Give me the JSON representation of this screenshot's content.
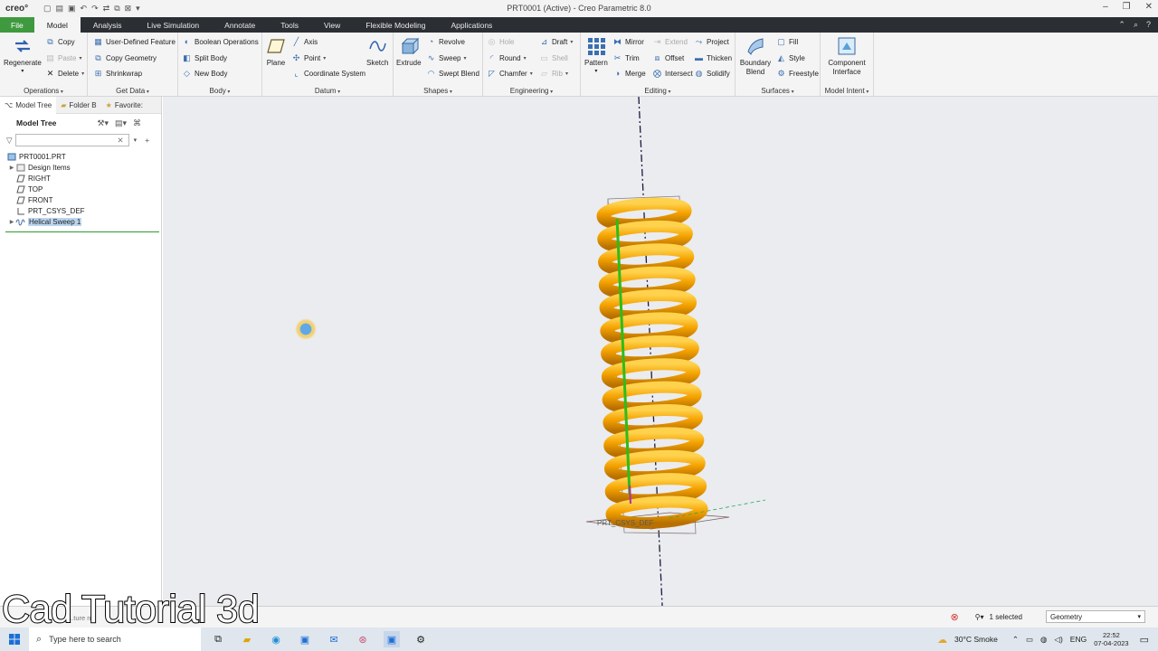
{
  "app": {
    "logo": "creo°",
    "window_title": "PRT0001 (Active) - Creo Parametric 8.0"
  },
  "menu": {
    "tabs": [
      "File",
      "Model",
      "Analysis",
      "Live Simulation",
      "Annotate",
      "Tools",
      "View",
      "Flexible Modeling",
      "Applications"
    ]
  },
  "ribbon": {
    "operations": {
      "title": "Operations",
      "regenerate": "Regenerate",
      "copy": "Copy",
      "paste": "Paste",
      "delete": "Delete"
    },
    "get_data": {
      "title": "Get Data",
      "udf": "User-Defined Feature",
      "copy_geometry": "Copy Geometry",
      "shrinkwrap": "Shrinkwrap"
    },
    "body": {
      "title": "Body",
      "boolean": "Boolean Operations",
      "split": "Split Body",
      "new": "New Body"
    },
    "datum": {
      "title": "Datum",
      "plane": "Plane",
      "axis": "Axis",
      "point": "Point",
      "csys": "Coordinate System",
      "sketch": "Sketch"
    },
    "shapes": {
      "title": "Shapes",
      "extrude": "Extrude",
      "revolve": "Revolve",
      "sweep": "Sweep",
      "swept_blend": "Swept Blend"
    },
    "engineering": {
      "title": "Engineering",
      "hole": "Hole",
      "round": "Round",
      "chamfer": "Chamfer",
      "draft": "Draft",
      "shell": "Shell",
      "rib": "Rib"
    },
    "editing": {
      "title": "Editing",
      "pattern": "Pattern",
      "mirror": "Mirror",
      "trim": "Trim",
      "merge": "Merge",
      "extend": "Extend",
      "offset": "Offset",
      "intersect": "Intersect",
      "project": "Project",
      "thicken": "Thicken",
      "solidify": "Solidify"
    },
    "surfaces": {
      "title": "Surfaces",
      "boundary_blend": "Boundary Blend",
      "fill": "Fill",
      "style": "Style",
      "freestyle": "Freestyle"
    },
    "model_intent": {
      "title": "Model Intent",
      "component_interface": "Component Interface"
    }
  },
  "left_panel": {
    "tabs": [
      "Model Tree",
      "Folder B",
      "Favorite:"
    ],
    "tree_title": "Model Tree",
    "search_placeholder": "",
    "items": [
      {
        "label": "PRT0001.PRT"
      },
      {
        "label": "Design Items"
      },
      {
        "label": "RIGHT"
      },
      {
        "label": "TOP"
      },
      {
        "label": "FRONT"
      },
      {
        "label": "PRT_CSYS_DEF"
      },
      {
        "label": "Helical Sweep 1"
      }
    ]
  },
  "viewport": {
    "csys_label": "PRT_CSYS_DEF"
  },
  "status": {
    "hint": "...ture n...",
    "selected": "1 selected",
    "filter": "Geometry"
  },
  "watermark": "Cad Tutorial 3d",
  "taskbar": {
    "search_placeholder": "Type here to search",
    "weather": "30°C  Smoke",
    "lang": "ENG",
    "time": "22:52",
    "date": "07-04-2023"
  }
}
